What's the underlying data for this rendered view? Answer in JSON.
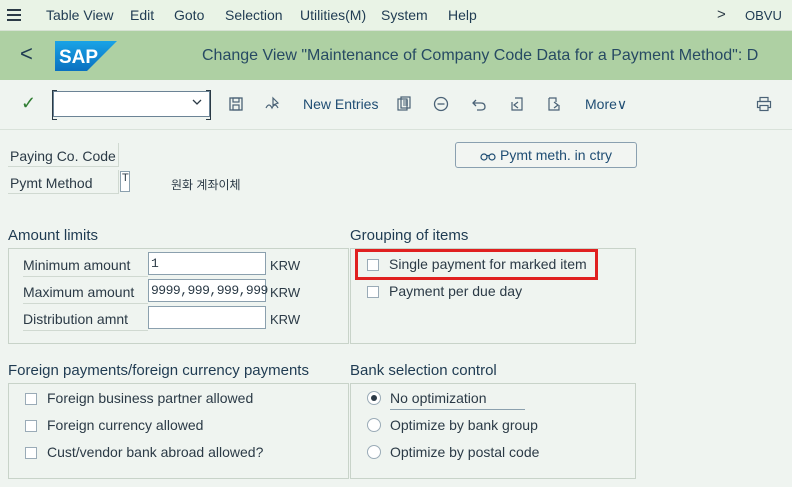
{
  "menu": {
    "items": [
      "Table View",
      "Edit",
      "Goto",
      "Selection",
      "Utilities(M)",
      "System",
      "Help"
    ],
    "system_id": "OBVU",
    "more_arrow": ">"
  },
  "header": {
    "back": "<",
    "logo_text": "SAP",
    "title": "Change View \"Maintenance of Company Code Data for a Payment Method\": D"
  },
  "toolbar": {
    "check": "✓",
    "command_value": "",
    "new_entries": "New Entries",
    "more": "More",
    "more_chevron": "∨"
  },
  "head_fields": {
    "paying_co_code_label": "Paying Co. Code",
    "pymt_method_label": "Pymt Method",
    "pymt_method_value": "T",
    "pymt_method_desc": "원화 계좌이체",
    "button_label": "Pymt meth. in ctry",
    "button_icon": "glasses-icon"
  },
  "amount_limits": {
    "title": "Amount limits",
    "rows": [
      {
        "label": "Minimum amount",
        "value": "1",
        "unit": "KRW"
      },
      {
        "label": "Maximum amount",
        "value": "9999,999,999,999",
        "unit": "KRW"
      },
      {
        "label": "Distribution amnt",
        "value": "",
        "unit": "KRW"
      }
    ]
  },
  "grouping": {
    "title": "Grouping of items",
    "options": [
      {
        "label": "Single payment for marked item",
        "checked": false
      },
      {
        "label": "Payment per due day",
        "checked": false
      }
    ]
  },
  "foreign": {
    "title": "Foreign payments/foreign currency payments",
    "options": [
      {
        "label": "Foreign business partner allowed",
        "checked": false
      },
      {
        "label": "Foreign currency allowed",
        "checked": false
      },
      {
        "label": "Cust/vendor bank abroad allowed?",
        "checked": false
      }
    ]
  },
  "bank_selection": {
    "title": "Bank selection control",
    "options": [
      {
        "label": "No optimization",
        "selected": true
      },
      {
        "label": "Optimize by bank group",
        "selected": false
      },
      {
        "label": "Optimize by postal code",
        "selected": false
      }
    ]
  },
  "colors": {
    "header_bg": "#aed0a3",
    "menubar_bg": "#e9f3e6",
    "page_bg": "#eff4f0",
    "highlight": "#e02020",
    "link": "#1f4d73"
  }
}
